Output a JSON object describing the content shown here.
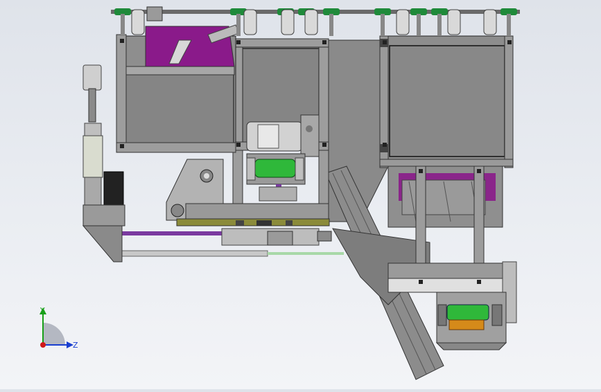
{
  "axes": {
    "y_label": "Y",
    "z_label": "Z",
    "y_color": "#18a018",
    "z_color": "#1a3fd0",
    "origin_color": "#d01818"
  },
  "colors": {
    "frame": "#8a8a8a",
    "panel": "#858585",
    "accent_purple": "#8a1a8a",
    "caster_green": "#1f8a3a",
    "roller_green": "#2fb83a",
    "motor_silver": "#cfcfcf",
    "base_plate": "#8b8b3a",
    "shaft_purple": "#7a3aa0",
    "rod_silver": "#c8c8c8"
  }
}
